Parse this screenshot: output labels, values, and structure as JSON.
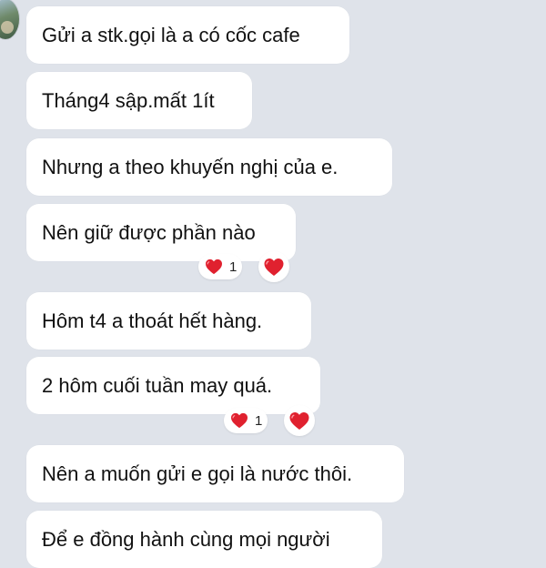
{
  "messages": [
    {
      "text": "Gửi a stk.gọi là a có cốc cafe"
    },
    {
      "text": "Tháng4 sập.mất 1ít"
    },
    {
      "text": "Nhưng a theo khuyến nghị của e."
    },
    {
      "text": "Nên giữ được phần nào",
      "reaction": {
        "emoji": "heart-icon",
        "count": "1"
      }
    },
    {
      "text": "Hôm t4 a thoát hết hàng."
    },
    {
      "text": "2 hôm cuối tuần may quá.",
      "reaction": {
        "emoji": "heart-icon",
        "count": "1"
      }
    },
    {
      "text": "Nên a muốn gửi e gọi là nước thôi."
    },
    {
      "text": "Để e đồng hành cùng mọi người"
    }
  ],
  "colors": {
    "background": "#dfe3ea",
    "bubble": "#ffffff",
    "heart": "#e0212f"
  }
}
